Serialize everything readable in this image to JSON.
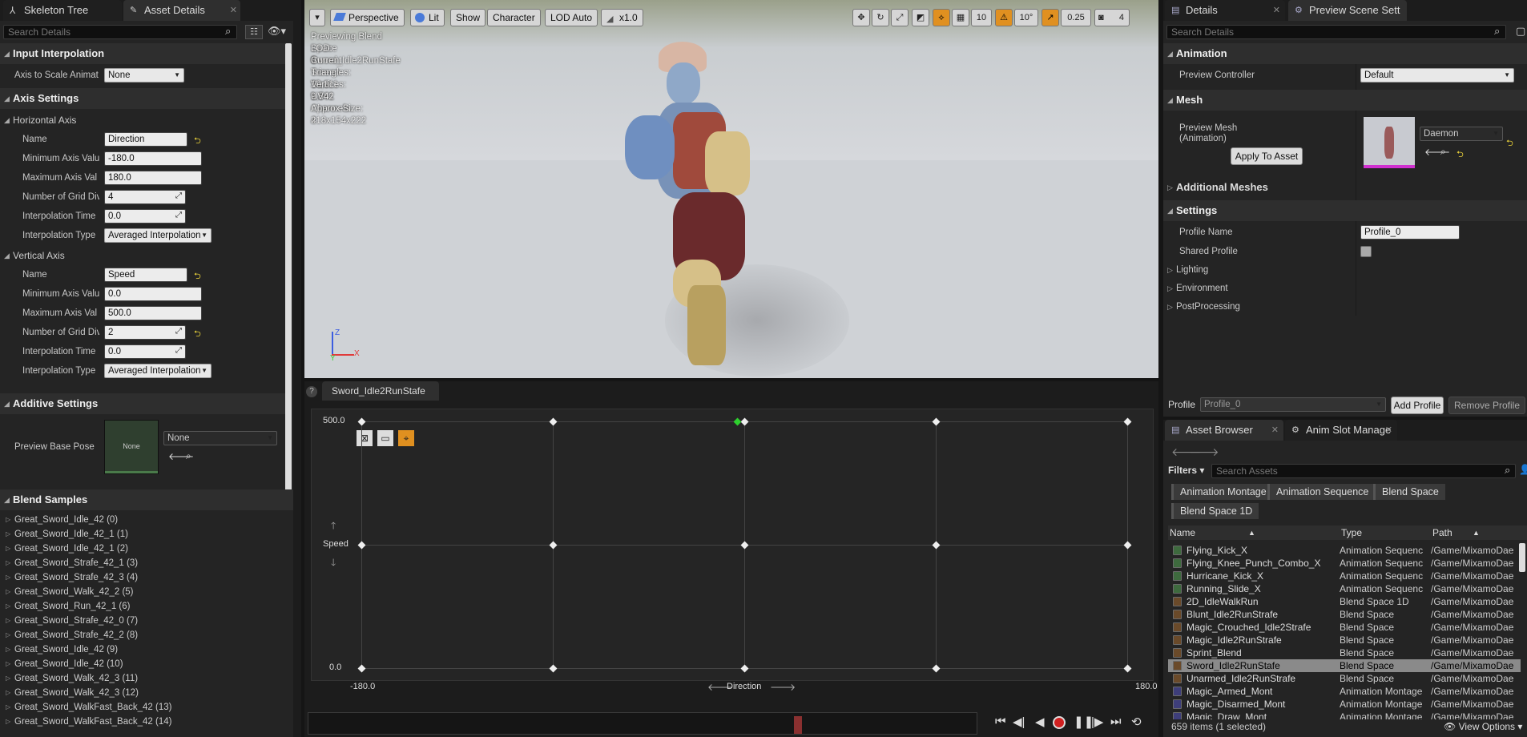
{
  "left_tabs": {
    "tab1": "Skeleton Tree",
    "tab2": "Asset Details"
  },
  "left_search": "Search Details",
  "input_interp": {
    "title": "Input Interpolation",
    "axis_scale_label": "Axis to Scale Animat",
    "axis_scale_value": "None"
  },
  "axis_settings": {
    "title": "Axis Settings",
    "h": {
      "title": "Horizontal Axis",
      "name_label": "Name",
      "name": "Direction",
      "min_label": "Minimum Axis Valu",
      "min": "-180.0",
      "max_label": "Maximum Axis Val",
      "max": "180.0",
      "grid_label": "Number of Grid Div",
      "grid": "4",
      "itime_label": "Interpolation Time",
      "itime": "0.0",
      "itype_label": "Interpolation Type",
      "itype": "Averaged Interpolation"
    },
    "v": {
      "title": "Vertical Axis",
      "name_label": "Name",
      "name": "Speed",
      "min_label": "Minimum Axis Valu",
      "min": "0.0",
      "max_label": "Maximum Axis Val",
      "max": "500.0",
      "grid_label": "Number of Grid Div",
      "grid": "2",
      "itime_label": "Interpolation Time",
      "itime": "0.0",
      "itype_label": "Interpolation Type",
      "itype": "Averaged Interpolation"
    }
  },
  "additive": {
    "title": "Additive Settings",
    "pose_label": "Preview Base Pose",
    "thumb": "None",
    "pose_value": "None"
  },
  "blend_samples": {
    "title": "Blend Samples",
    "items": [
      "Great_Sword_Idle_42 (0)",
      "Great_Sword_Idle_42_1 (1)",
      "Great_Sword_Idle_42_1 (2)",
      "Great_Sword_Strafe_42_1 (3)",
      "Great_Sword_Strafe_42_3 (4)",
      "Great_Sword_Walk_42_2 (5)",
      "Great_Sword_Run_42_1 (6)",
      "Great_Sword_Strafe_42_0 (7)",
      "Great_Sword_Strafe_42_2 (8)",
      "Great_Sword_Idle_42 (9)",
      "Great_Sword_Idle_42 (10)",
      "Great_Sword_Walk_42_3 (11)",
      "Great_Sword_Walk_42_3 (12)",
      "Great_Sword_WalkFast_Back_42 (13)",
      "Great_Sword_WalkFast_Back_42 (14)"
    ]
  },
  "viewport": {
    "perspective": "Perspective",
    "lit": "Lit",
    "show": "Show",
    "character": "Character",
    "lod": "LOD Auto",
    "speed": "x1.0",
    "grid_snap": "10",
    "rot_snap": "10°",
    "scale_snap": "0.25",
    "cam_speed": "4",
    "info": [
      "Previewing Blend Space Sword_Idle2RunStafe",
      "LOD: 0",
      "Current Screen Size: 1.361",
      "Triangles: 16,311",
      "Vertices: 9,542",
      "UV Channels: 4",
      "Approx Size: 218x154x222"
    ],
    "axis_z": "Z",
    "axis_x": "X",
    "axis_y": "Y"
  },
  "blend_editor": {
    "tab": "Sword_Idle2RunStafe",
    "y_max": "500.0",
    "y_min": "0.0",
    "y_label": "Speed",
    "x_min": "-180.0",
    "x_max": "180.0",
    "x_label": "Direction"
  },
  "details_tabs": {
    "tab1": "Details",
    "tab2": "Preview Scene Sett"
  },
  "details_search": "Search Details",
  "details": {
    "animation": "Animation",
    "preview_controller_label": "Preview Controller",
    "preview_controller": "Default",
    "mesh": "Mesh",
    "preview_mesh_label": "Preview Mesh",
    "preview_mesh_sub": "(Animation)",
    "mesh_value": "Daemon",
    "apply_btn": "Apply To Asset",
    "additional_meshes": "Additional Meshes",
    "settings": "Settings",
    "profile_name_label": "Profile Name",
    "profile_name": "Profile_0",
    "shared_profile_label": "Shared Profile",
    "lighting": "Lighting",
    "environment": "Environment",
    "postprocessing": "PostProcessing",
    "profile_label": "Profile",
    "profile_value": "Profile_0",
    "add_profile": "Add Profile",
    "remove_profile": "Remove Profile"
  },
  "asset_tabs": {
    "tab1": "Asset Browser",
    "tab2": "Anim Slot Manage"
  },
  "asset_browser": {
    "filters": "Filters",
    "search": "Search Assets",
    "chips": [
      "Animation Montage",
      "Animation Sequence",
      "Blend Space",
      "Blend Space 1D"
    ],
    "col_name": "Name",
    "col_type": "Type",
    "col_path": "Path",
    "rows": [
      {
        "name": "Flying_Kick_X",
        "type": "Animation Sequenc",
        "path": "/Game/MixamoDae",
        "kind": "seq"
      },
      {
        "name": "Flying_Knee_Punch_Combo_X",
        "type": "Animation Sequenc",
        "path": "/Game/MixamoDae",
        "kind": "seq"
      },
      {
        "name": "Hurricane_Kick_X",
        "type": "Animation Sequenc",
        "path": "/Game/MixamoDae",
        "kind": "seq"
      },
      {
        "name": "Running_Slide_X",
        "type": "Animation Sequenc",
        "path": "/Game/MixamoDae",
        "kind": "seq"
      },
      {
        "name": "2D_IdleWalkRun",
        "type": "Blend Space 1D",
        "path": "/Game/MixamoDae",
        "kind": "bs"
      },
      {
        "name": "Blunt_Idle2RunStrafe",
        "type": "Blend Space",
        "path": "/Game/MixamoDae",
        "kind": "bs"
      },
      {
        "name": "Magic_Crouched_Idle2Strafe",
        "type": "Blend Space",
        "path": "/Game/MixamoDae",
        "kind": "bs"
      },
      {
        "name": "Magic_Idle2RunStrafe",
        "type": "Blend Space",
        "path": "/Game/MixamoDae",
        "kind": "bs"
      },
      {
        "name": "Sprint_Blend",
        "type": "Blend Space",
        "path": "/Game/MixamoDae",
        "kind": "bs"
      },
      {
        "name": "Sword_Idle2RunStafe",
        "type": "Blend Space",
        "path": "/Game/MixamoDae",
        "kind": "bs"
      },
      {
        "name": "Unarmed_Idle2RunStrafe",
        "type": "Blend Space",
        "path": "/Game/MixamoDae",
        "kind": "bs"
      },
      {
        "name": "Magic_Armed_Mont",
        "type": "Animation Montage",
        "path": "/Game/MixamoDae",
        "kind": "mon"
      },
      {
        "name": "Magic_Disarmed_Mont",
        "type": "Animation Montage",
        "path": "/Game/MixamoDae",
        "kind": "mon"
      },
      {
        "name": "Magic_Draw_Mont",
        "type": "Animation Montage",
        "path": "/Game/MixamoDae",
        "kind": "mon"
      }
    ],
    "status": "659 items (1 selected)",
    "view_options": "View Options"
  },
  "colors": {
    "accent": "#e09020",
    "selected_row": "#8a8a8a",
    "bg": "#242424"
  }
}
